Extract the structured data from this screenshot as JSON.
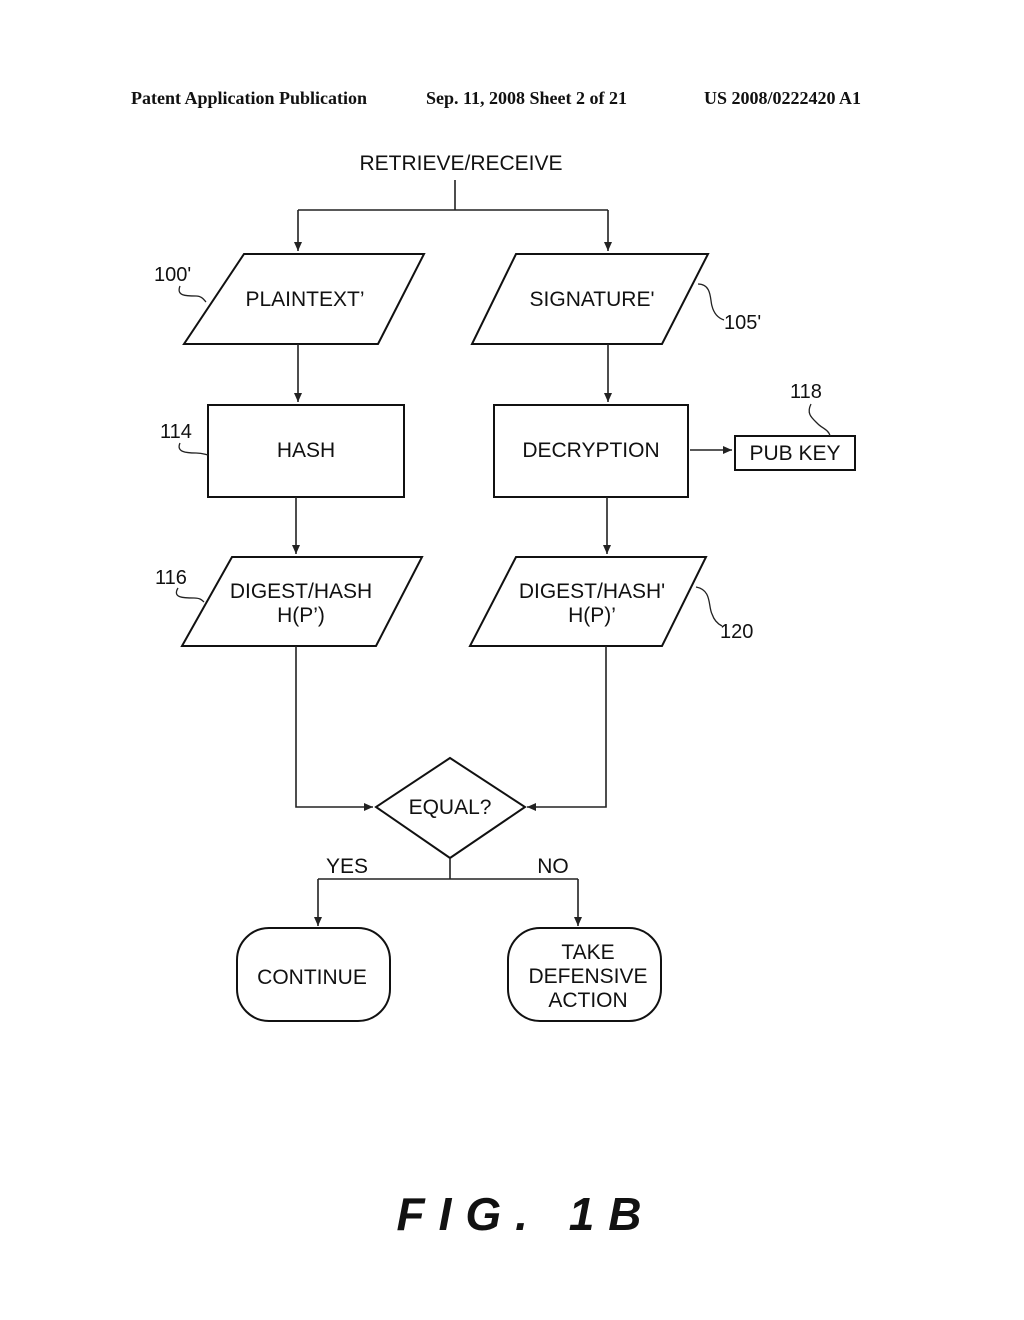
{
  "header": {
    "publication": "Patent Application Publication",
    "date_sheet": "Sep. 11, 2008   Sheet 2 of 21",
    "number": "US 2008/0222420 A1"
  },
  "diagram": {
    "start_label": "RETRIEVE/RECEIVE",
    "nodes": {
      "plaintext": {
        "label": "PLAINTEXT’",
        "ref": "100'",
        "shape": "parallelogram"
      },
      "signature": {
        "label": "SIGNATURE'",
        "ref": "105'",
        "shape": "parallelogram"
      },
      "hash": {
        "label": "HASH",
        "ref": "114",
        "shape": "rectangle"
      },
      "decryption": {
        "label": "DECRYPTION",
        "shape": "rectangle"
      },
      "pubkey": {
        "label": "PUB KEY",
        "ref": "118",
        "shape": "rectangle"
      },
      "digest_left": {
        "line1": "DIGEST/HASH",
        "line2": "H(P’)",
        "ref": "116",
        "shape": "parallelogram"
      },
      "digest_right": {
        "line1": "DIGEST/HASH'",
        "line2": "H(P)’",
        "ref": "120",
        "shape": "parallelogram"
      },
      "equal": {
        "label": "EQUAL?",
        "shape": "diamond"
      },
      "continue": {
        "label": "CONTINUE",
        "shape": "rounded-rectangle"
      },
      "defensive": {
        "line1": "TAKE",
        "line2": "DEFENSIVE",
        "line3": "ACTION",
        "shape": "rounded-rectangle"
      }
    },
    "branches": {
      "yes": "YES",
      "no": "NO"
    },
    "edges": [
      [
        "start",
        "plaintext"
      ],
      [
        "start",
        "signature"
      ],
      [
        "plaintext",
        "hash"
      ],
      [
        "signature",
        "decryption"
      ],
      [
        "decryption",
        "pubkey"
      ],
      [
        "hash",
        "digest_left"
      ],
      [
        "decryption",
        "digest_right"
      ],
      [
        "digest_left",
        "equal"
      ],
      [
        "digest_right",
        "equal"
      ],
      [
        "equal",
        "continue"
      ],
      [
        "equal",
        "defensive"
      ]
    ]
  },
  "figure_label": "FIG. 1B"
}
